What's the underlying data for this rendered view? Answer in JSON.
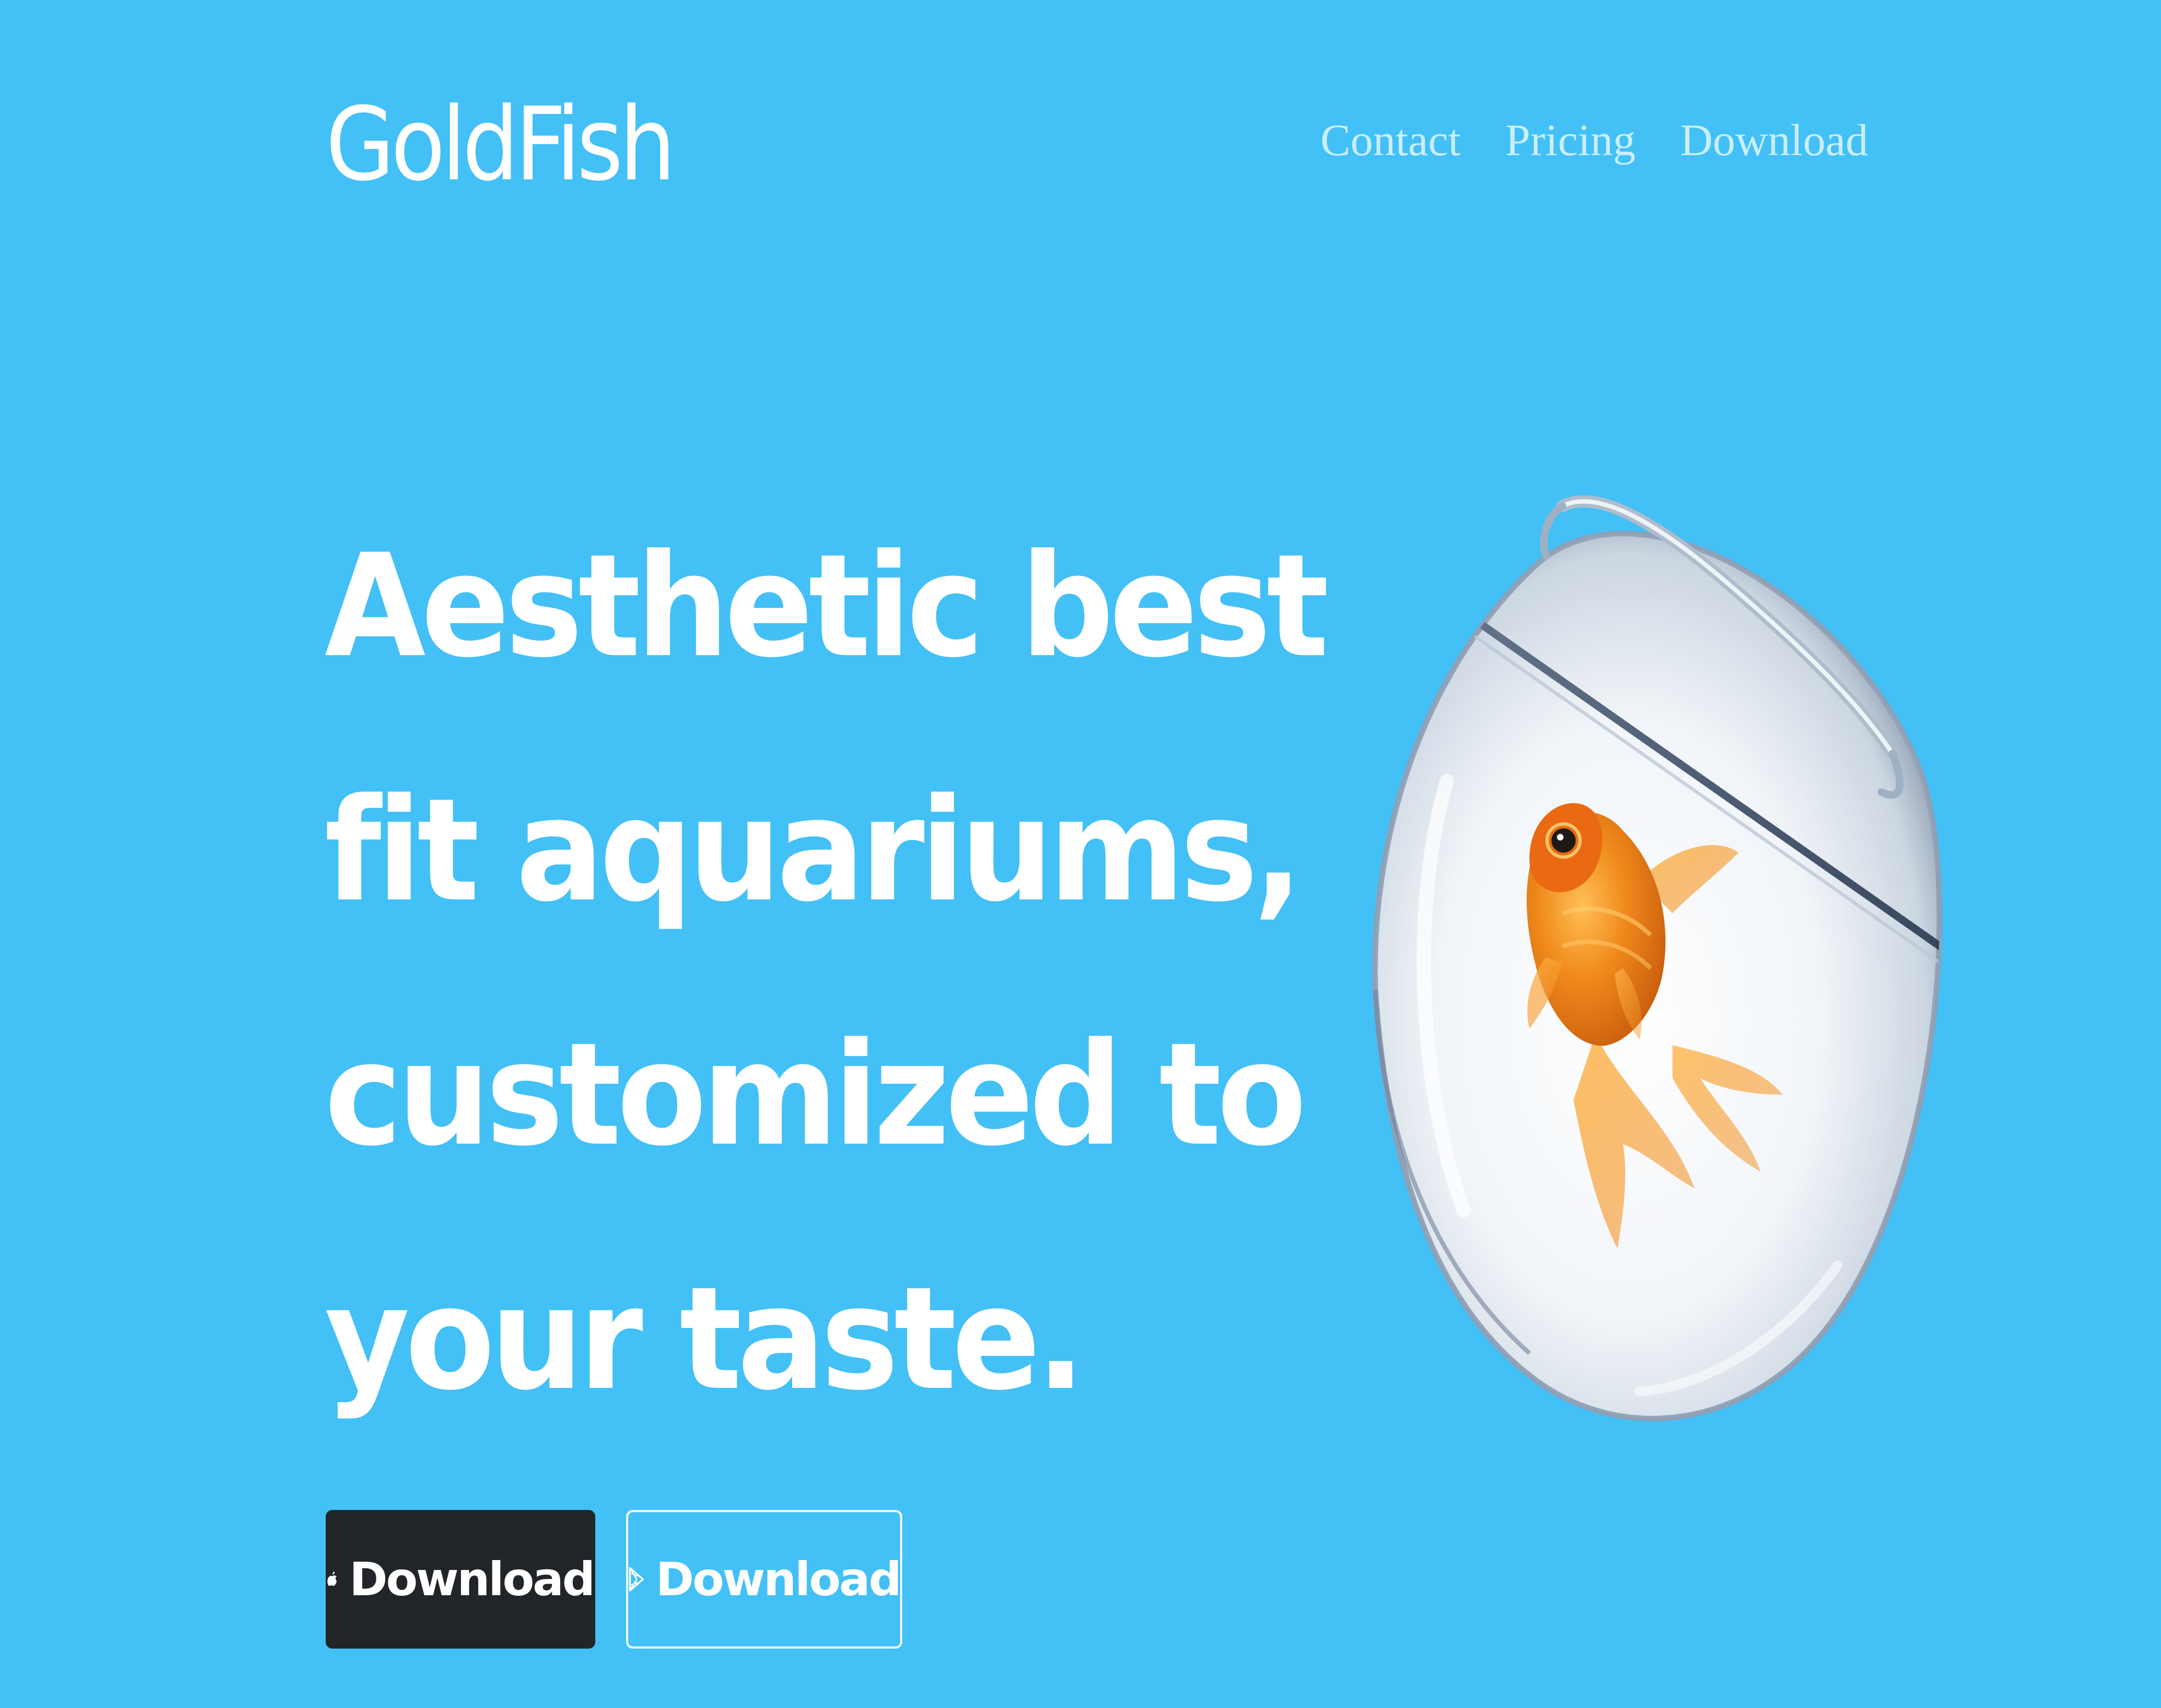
{
  "brand": {
    "name": "GoldFish"
  },
  "nav": {
    "items": [
      {
        "label": "Contact"
      },
      {
        "label": "Pricing"
      },
      {
        "label": "Download"
      }
    ]
  },
  "hero": {
    "lines": [
      "Aesthetic best",
      "fit aquariums,",
      "customized to",
      "your taste."
    ]
  },
  "buttons": {
    "apple": {
      "label": "Download",
      "icon": "apple-icon"
    },
    "play": {
      "label": "Download",
      "icon": "play-store-icon"
    }
  },
  "illustration": {
    "name": "goldfish-in-bowl"
  },
  "colors": {
    "background": "#43c0f6",
    "text": "#ffffff",
    "dark_button": "#212529",
    "fish": "#f08a1c"
  }
}
